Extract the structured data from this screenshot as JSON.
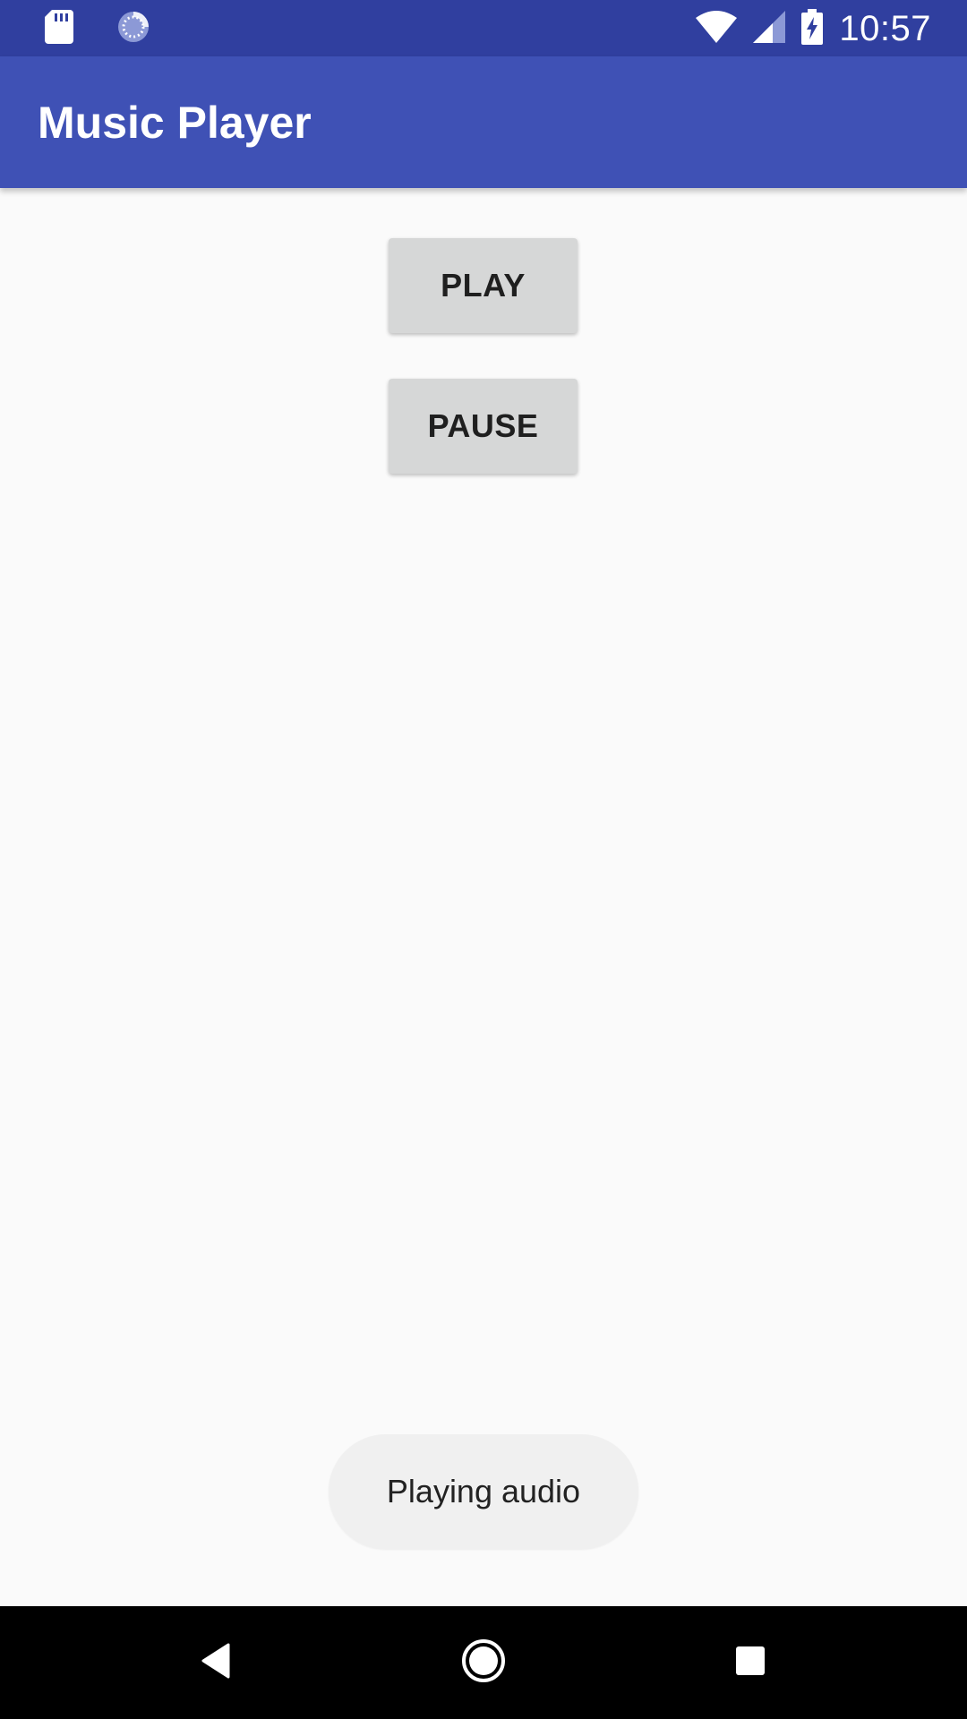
{
  "status_bar": {
    "time": "10:57",
    "icons": [
      "sd-card-icon",
      "sync-icon",
      "wifi-icon",
      "cell-signal-icon",
      "battery-charging-icon"
    ]
  },
  "app_bar": {
    "title": "Music Player"
  },
  "buttons": {
    "play_label": "PLAY",
    "pause_label": "PAUSE"
  },
  "toast": {
    "message": "Playing audio"
  },
  "nav_bar": {
    "icons": [
      "back-icon",
      "home-icon",
      "recents-icon"
    ]
  },
  "colors": {
    "status_bar": "#303f9f",
    "app_bar": "#3f51b5",
    "background": "#fafafa",
    "button": "#d6d7d7",
    "toast": "#f0f0f0",
    "nav_bar": "#000000"
  }
}
